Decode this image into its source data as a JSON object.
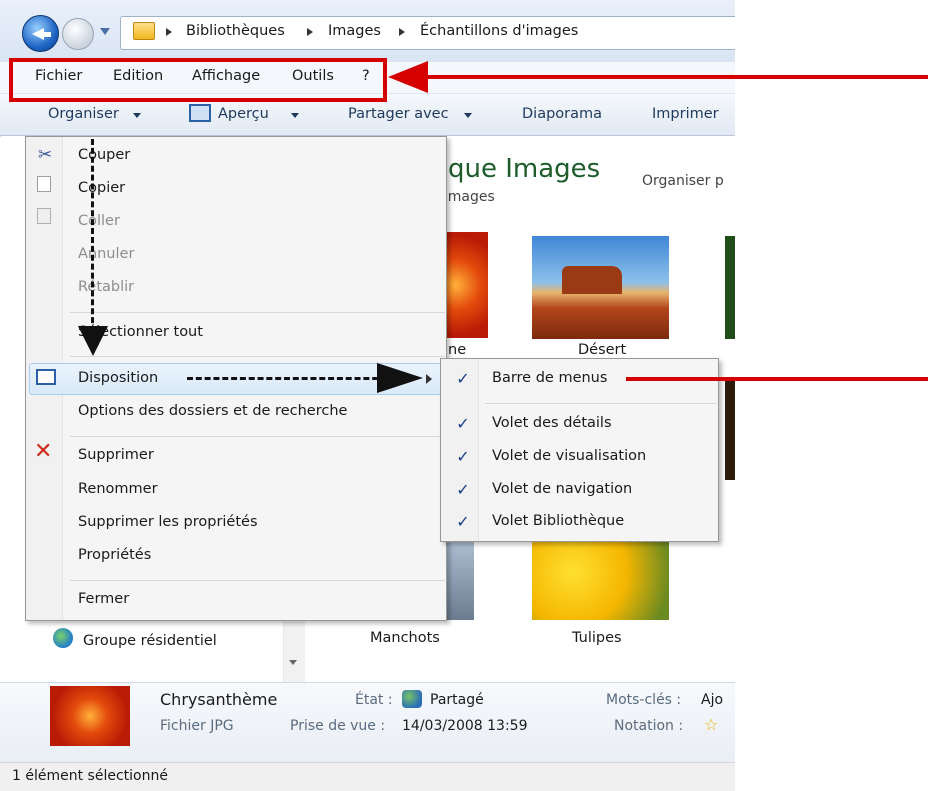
{
  "breadcrumb": [
    "Bibliothèques",
    "Images",
    "Échantillons d'images"
  ],
  "menubar": [
    "Fichier",
    "Edition",
    "Affichage",
    "Outils",
    "?"
  ],
  "toolbar": {
    "organiser": "Organiser",
    "apercu": "Aperçu",
    "partager": "Partager avec",
    "diaporama": "Diaporama",
    "imprimer": "Imprimer"
  },
  "library": {
    "title": "que Images",
    "subtitle": "'images",
    "arrange": "Organiser p"
  },
  "thumbnails": {
    "chrys_partial": "ne",
    "desert": "Désert",
    "manchots": "Manchots",
    "tulipes": "Tulipes"
  },
  "navpane": {
    "groupe": "Groupe résidentiel"
  },
  "menu": {
    "couper": "Couper",
    "copier": "Copier",
    "coller": "Coller",
    "annuler": "Annuler",
    "retablir": "Rétablir",
    "select_all": "Sélectionner tout",
    "disposition": "Disposition",
    "options": "Options des dossiers et de recherche",
    "supprimer": "Supprimer",
    "renommer": "Renommer",
    "suppr_props": "Supprimer les propriétés",
    "proprietes": "Propriétés",
    "fermer": "Fermer"
  },
  "submenu": [
    {
      "label": "Barre de menus",
      "checked": true
    },
    {
      "label": "Volet des détails",
      "checked": true
    },
    {
      "label": "Volet de visualisation",
      "checked": true
    },
    {
      "label": "Volet de navigation",
      "checked": true
    },
    {
      "label": "Volet Bibliothèque",
      "checked": true
    }
  ],
  "details": {
    "name": "Chrysanthème",
    "type": "Fichier JPG",
    "etat_label": "État :",
    "etat_value": "Partagé",
    "prise_label": "Prise de vue :",
    "prise_value": "14/03/2008 13:59",
    "mots_label": "Mots-clés :",
    "mots_value": "Ajo",
    "notation_label": "Notation :"
  },
  "status": "1 élément sélectionné",
  "colors": {
    "annotation_red": "#d50000",
    "highlight_blue": "#d9e9f8",
    "library_green": "#1e5c2c"
  }
}
